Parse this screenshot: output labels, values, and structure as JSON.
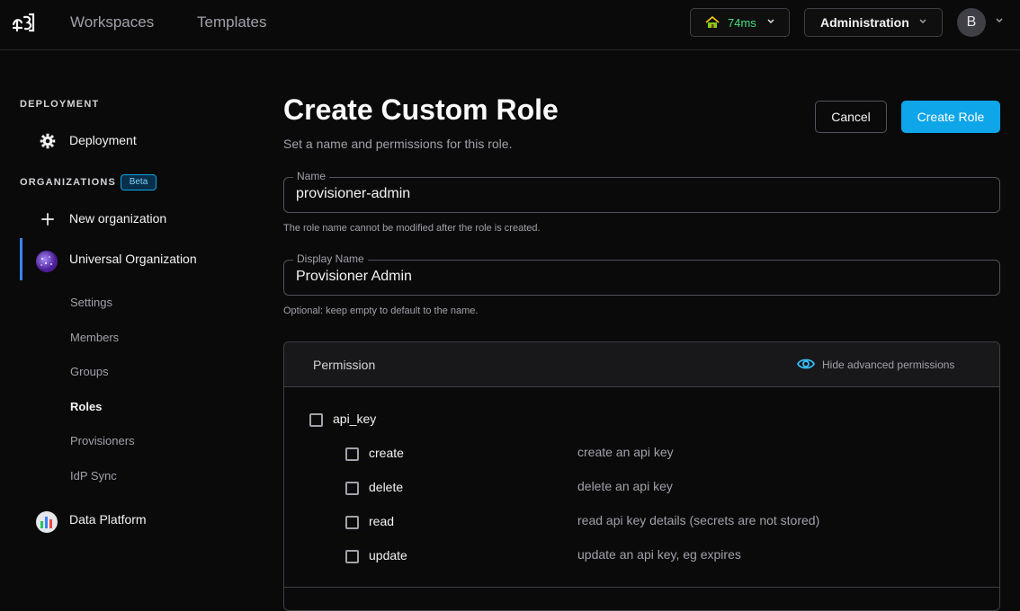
{
  "topbar": {
    "nav": [
      "Workspaces",
      "Templates"
    ],
    "latency": "74ms",
    "admin_label": "Administration",
    "avatar_initial": "B"
  },
  "sidebar": {
    "deployment_heading": "DEPLOYMENT",
    "deployment_item": "Deployment",
    "organizations_heading": "ORGANIZATIONS",
    "beta_badge": "Beta",
    "new_org": "New organization",
    "current_org": "Universal Organization",
    "sub_items": [
      "Settings",
      "Members",
      "Groups",
      "Roles",
      "Provisioners",
      "IdP Sync"
    ],
    "active_sub": "Roles",
    "other_org": "Data Platform"
  },
  "main": {
    "title": "Create Custom Role",
    "subtitle": "Set a name and permissions for this role.",
    "cancel_label": "Cancel",
    "create_label": "Create Role",
    "name_field": {
      "label": "Name",
      "value": "provisioner-admin",
      "helper": "The role name cannot be modified after the role is created."
    },
    "display_name_field": {
      "label": "Display Name",
      "value": "Provisioner Admin",
      "helper": "Optional: keep empty to default to the name."
    },
    "permissions": {
      "header": "Permission",
      "toggle_label": "Hide advanced permissions",
      "resource": "api_key",
      "actions": [
        {
          "name": "create",
          "description": "create an api key"
        },
        {
          "name": "delete",
          "description": "delete an api key"
        },
        {
          "name": "read",
          "description": "read api key details (secrets are not stored)"
        },
        {
          "name": "update",
          "description": "update an api key, eg expires"
        }
      ]
    }
  },
  "colors": {
    "accent": "#0ea5e9",
    "latency_green": "#4ade80",
    "active_indicator": "#3b82f6"
  }
}
